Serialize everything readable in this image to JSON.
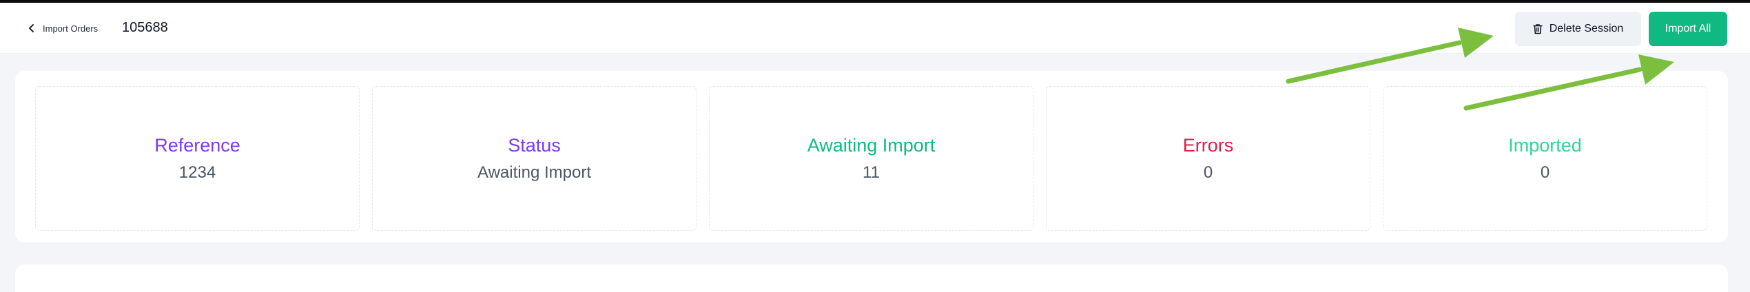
{
  "header": {
    "back_label": "Import Orders",
    "order_number": "105688",
    "delete_label": "Delete Session",
    "import_label": "Import All"
  },
  "stats": [
    {
      "label": "Reference",
      "value": "1234",
      "color": "#7c3aed"
    },
    {
      "label": "Status",
      "value": "Awaiting Import",
      "color": "#7c3aed"
    },
    {
      "label": "Awaiting Import",
      "value": "11",
      "color": "#10b981"
    },
    {
      "label": "Errors",
      "value": "0",
      "color": "#e11d48"
    },
    {
      "label": "Imported",
      "value": "0",
      "color": "#34d399"
    }
  ],
  "colors": {
    "accent": "#10b981",
    "annotation_arrow": "#7cbf3e"
  },
  "icons": {
    "back": "chevron-left-icon",
    "delete": "trash-icon"
  }
}
